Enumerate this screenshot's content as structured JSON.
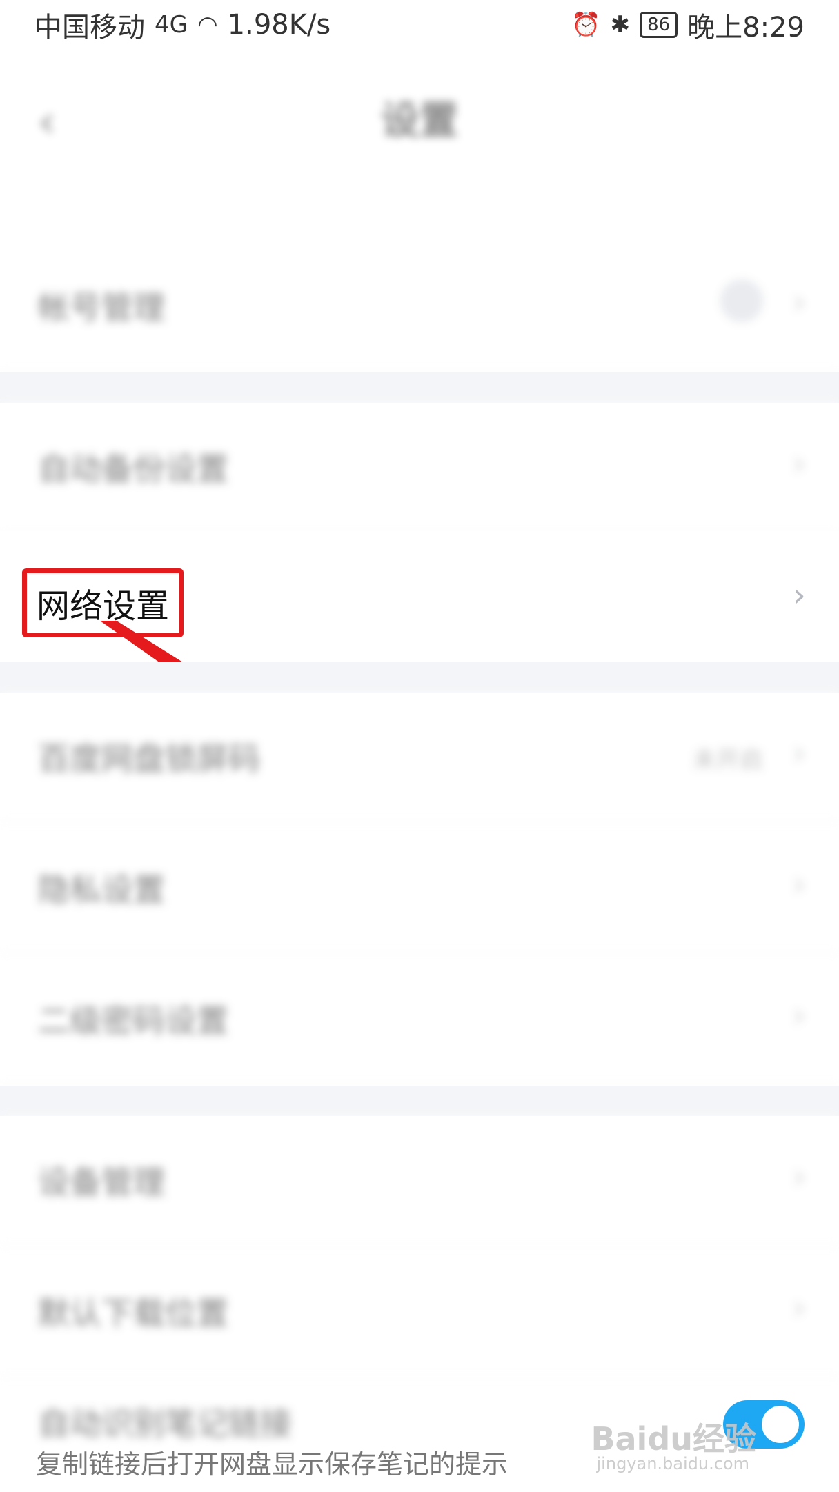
{
  "status_bar": {
    "carrier": "中国移动",
    "network": "4G",
    "speed": "1.98K/s",
    "battery": "86",
    "time": "晚上8:29"
  },
  "nav": {
    "back_glyph": "‹",
    "title": "设置"
  },
  "rows": [
    {
      "label": "帐号管理"
    },
    {
      "label": "自动备份设置"
    },
    {
      "label": "网络设置"
    },
    {
      "label": "百度网盘锁屏码",
      "value": "未开启"
    },
    {
      "label": "隐私设置"
    },
    {
      "label": "二级密码设置"
    },
    {
      "label": "设备管理"
    },
    {
      "label": "默认下载位置"
    },
    {
      "label": "自动识别笔记链接",
      "hint": "复制链接后打开网盘显示保存笔记的提示"
    }
  ],
  "watermark": {
    "brand": "Baidu经验",
    "url": "jingyan.baidu.com"
  },
  "colors": {
    "highlight": "#e41a1c",
    "toggle_on": "#1ea7f3",
    "separator": "#f4f5f8"
  }
}
